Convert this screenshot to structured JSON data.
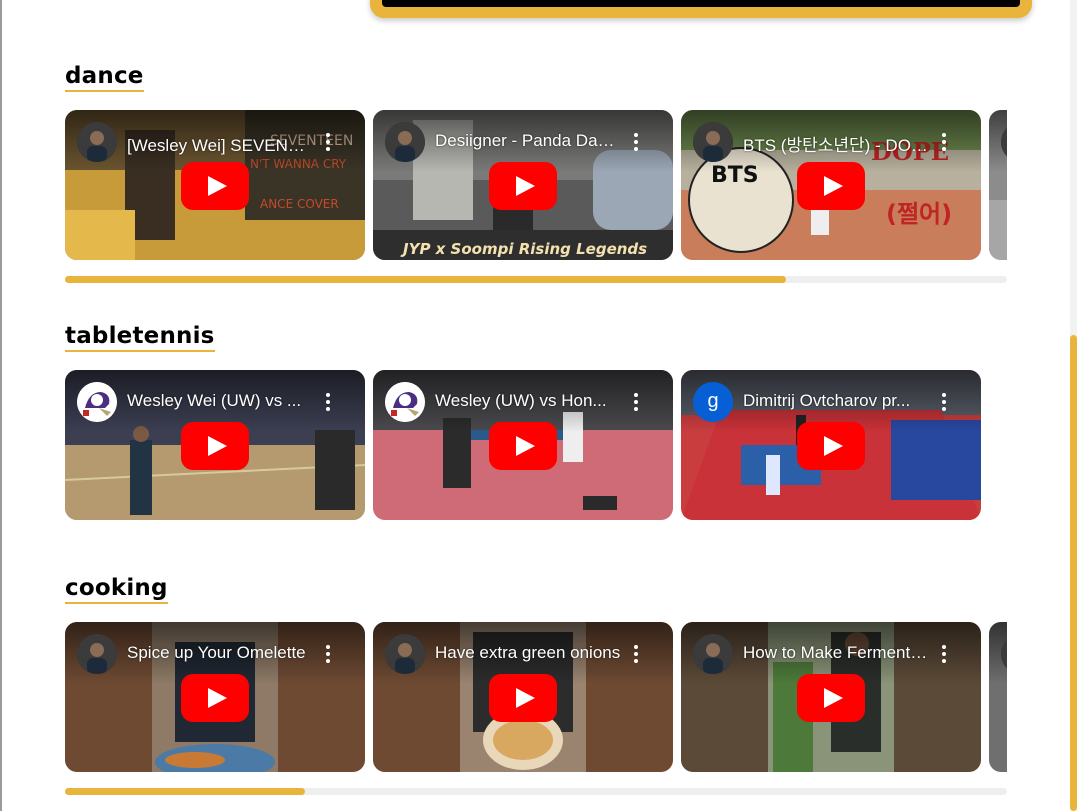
{
  "sections": [
    {
      "title": "dance",
      "scroll_fraction": 0.765,
      "videos": [
        {
          "title": "[Wesley Wei] SEVENTEEN(세븐틴) - 울고 싶지 않아 (Don't Wanna Cry) Dance Cover",
          "avatar": "person",
          "thumb": "dance1"
        },
        {
          "title": "Desiigner - Panda Dance Cover",
          "avatar": "person",
          "thumb": "dance2"
        },
        {
          "title": "BTS (방탄소년단) - DOPE Dance Cover",
          "avatar": "person",
          "thumb": "dance3"
        },
        {
          "title": "",
          "avatar": "person",
          "thumb": "grey"
        }
      ]
    },
    {
      "title": "tabletennis",
      "scroll_fraction": 1.0,
      "videos": [
        {
          "title": "Wesley Wei (UW) vs ...",
          "avatar": "husky",
          "thumb": "tt1"
        },
        {
          "title": "Wesley (UW) vs Hon...",
          "avatar": "husky",
          "thumb": "tt2"
        },
        {
          "title": "Dimitrij Ovtcharov pr...",
          "avatar": "letter",
          "avatar_letter": "g",
          "thumb": "tt3"
        }
      ]
    },
    {
      "title": "cooking",
      "scroll_fraction": 0.255,
      "videos": [
        {
          "title": "Spice up Your Omelette",
          "avatar": "person",
          "thumb": "cook1"
        },
        {
          "title": "Have extra green onions",
          "avatar": "person",
          "thumb": "cook2"
        },
        {
          "title": "How to Make Fermented",
          "avatar": "person",
          "thumb": "cook3"
        },
        {
          "title": "",
          "avatar": "person",
          "thumb": "grey"
        }
      ]
    }
  ],
  "colors": {
    "accent": "#e8b43b",
    "youtube_red": "#ff0000"
  },
  "icons": [
    "play-button-icon",
    "more-vert-icon",
    "channel-avatar-icon"
  ]
}
